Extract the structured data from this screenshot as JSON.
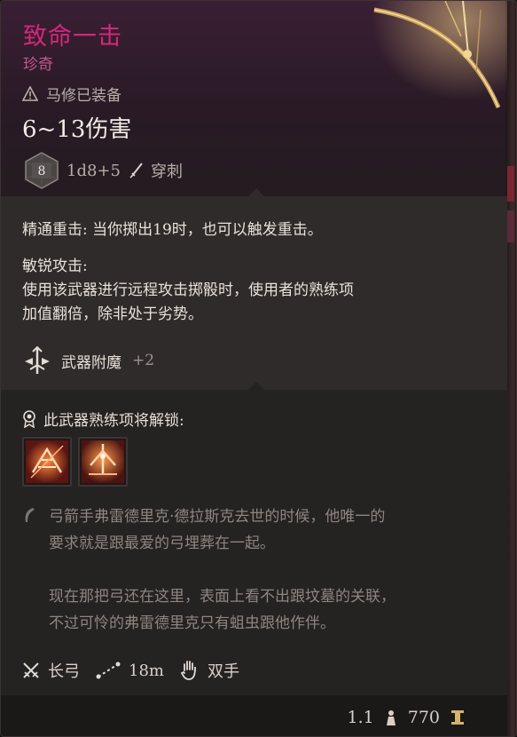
{
  "item": {
    "name": "致命一击",
    "rarity": "珍奇",
    "equipped_by": "马修已装备",
    "damage": "6~13伤害",
    "dice_face": "8",
    "dice_formula": "1d8+5",
    "damage_type": "穿刺",
    "weight": "1.1",
    "value": "770"
  },
  "passives": {
    "crit_mastery": "精通重击: 当你掷出19时，也可以触发重击。",
    "sharp_attack_title": "敏锐攻击:",
    "sharp_attack_line1": "使用该武器进行远程攻击掷骰时，使用者的熟练项",
    "sharp_attack_line2": "加值翻倍，除非处于劣势。",
    "enchant_label": "武器附魔",
    "enchant_value": "+2"
  },
  "proficiency": {
    "unlock_label": "此武器熟练项将解锁:",
    "skills": [
      {
        "icon": "flame-arrow-skill-icon"
      },
      {
        "icon": "fire-pierce-skill-icon"
      }
    ]
  },
  "lore": {
    "para1_line1": "弓箭手弗雷德里克·德拉斯克去世的时候，他唯一的",
    "para1_line2": "要求就是跟最爱的弓埋葬在一起。",
    "para2_line1": "现在那把弓还在这里，表面上看不出跟坟墓的关联，",
    "para2_line2": "不过可怜的弗雷德里克只有蛆虫跟他作伴。"
  },
  "properties": {
    "weapon_type": "长弓",
    "range": "18m",
    "handedness": "双手"
  },
  "colors": {
    "rarity_accent": "#d4277a",
    "lore_text": "#8d8680",
    "enchant_plus": "#9b938b"
  }
}
